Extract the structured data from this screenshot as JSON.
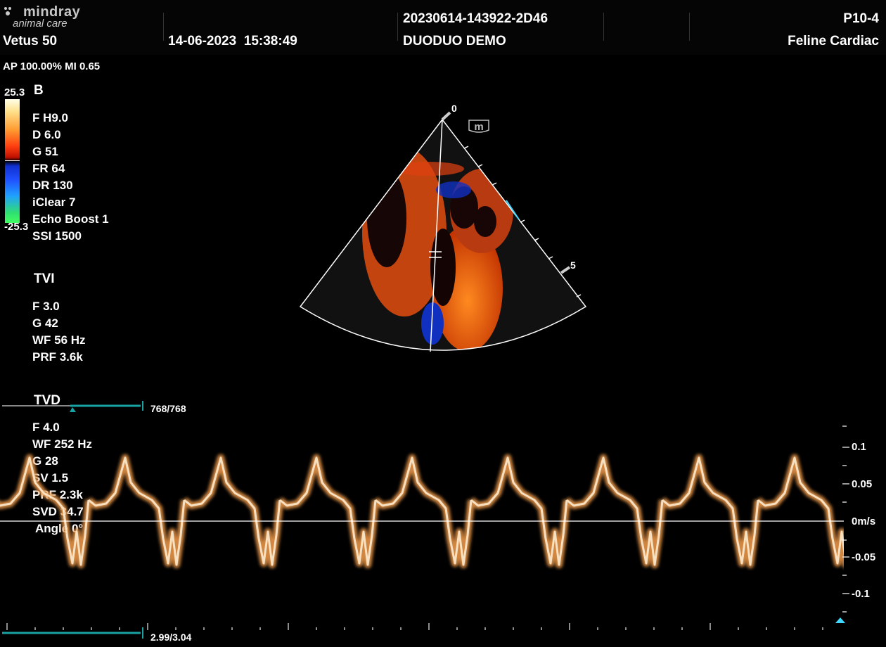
{
  "header": {
    "brand_main": "mindray",
    "brand_sub": "animal care",
    "device": "Vetus 50",
    "date": "14-06-2023",
    "time": "15:38:49",
    "study_id": "20230614-143922-2D46",
    "patient": "DUODUO DEMO",
    "probe": "P10-4",
    "preset": "Feline Cardiac"
  },
  "power_line": "AP 100.00%  MI 0.65",
  "colorbar": {
    "max": "25.3",
    "min": "-25.3"
  },
  "b_mode": {
    "title": "B",
    "params": [
      "F H9.0",
      "D 6.0",
      "G 51",
      "FR 64",
      "DR 130",
      "iClear 7",
      "Echo Boost 1",
      "SSI 1500"
    ]
  },
  "tvi": {
    "title": "TVI",
    "params": [
      "F 3.0",
      "G 42",
      "WF 56 Hz",
      "PRF 3.6k"
    ]
  },
  "tvd": {
    "title": "TVD",
    "params": [
      "F 4.0",
      "WF 252 Hz",
      "G 28",
      "SV 1.5",
      "PRF 2.3k",
      "SVD 34.7",
      "Angle    0°"
    ]
  },
  "sector": {
    "depth_top": "0",
    "depth_mark": "5",
    "m_icon": "m-badge-icon"
  },
  "cine": {
    "top_counter": "768/768",
    "bottom_counter": "2.99/3.04"
  },
  "velocity_scale": {
    "ticks": [
      "0.1",
      "0.05",
      "0m/s",
      "-0.05",
      "-0.1"
    ]
  },
  "colors": {
    "accent_teal": "#1aa3a3",
    "cyan_marker": "#3fd9ff",
    "spectral_orange": "#f0a050"
  }
}
